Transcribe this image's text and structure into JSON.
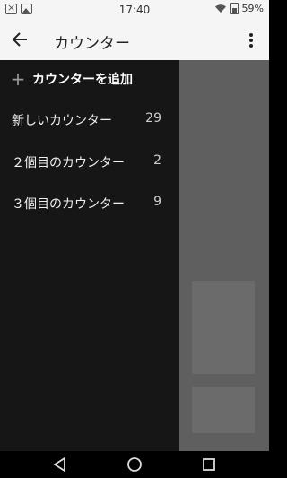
{
  "status_bar": {
    "time": "17:40",
    "battery": "59%",
    "icons": [
      "notification-x-icon",
      "image-icon",
      "wifi-icon",
      "battery-icon"
    ]
  },
  "toolbar": {
    "title": "カウンター",
    "back_icon": "arrow-back-icon",
    "menu_icon": "overflow-menu-icon"
  },
  "drawer": {
    "add_label": "カウンターを追加",
    "items": [
      {
        "name": "新しいカウンター",
        "count": "29"
      },
      {
        "name": "２個目のカウンター",
        "count": "2"
      },
      {
        "name": "３個目のカウンター",
        "count": "9"
      }
    ]
  },
  "nav_bar": {
    "icons": [
      "back-triangle-icon",
      "home-circle-icon",
      "recents-square-icon"
    ]
  },
  "colors": {
    "drawer_bg": "#161616",
    "scrim": "#5f5f5f",
    "toolbar_bg": "#f5f5f5"
  }
}
